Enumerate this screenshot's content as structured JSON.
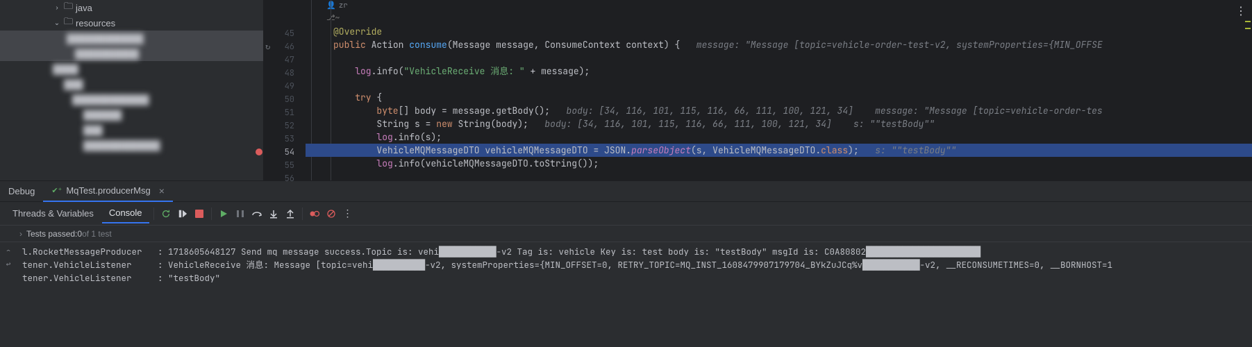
{
  "sidebar": {
    "items": [
      {
        "indent": 76,
        "chev": "›",
        "icon": "folder",
        "label": "java"
      },
      {
        "indent": 76,
        "chev": "⌄",
        "icon": "folder",
        "label": "resources"
      },
      {
        "indent": 96,
        "chev": "",
        "icon": "",
        "label": "████████████",
        "blur": true,
        "selected": true
      },
      {
        "indent": 108,
        "chev": "",
        "icon": "",
        "label": "██████████",
        "blur": true,
        "selected": true
      },
      {
        "indent": 76,
        "chev": "",
        "icon": "",
        "label": "████",
        "blur": true
      },
      {
        "indent": 92,
        "chev": "",
        "icon": "",
        "label": "███",
        "blur": true
      },
      {
        "indent": 104,
        "chev": "",
        "icon": "",
        "label": "████████████",
        "blur": true
      },
      {
        "indent": 120,
        "chev": "",
        "icon": "",
        "label": "██████",
        "blur": true
      },
      {
        "indent": 120,
        "chev": "",
        "icon": "",
        "label": "███",
        "blur": true
      },
      {
        "indent": 120,
        "chev": "",
        "icon": "",
        "label": "████████████",
        "blur": true
      }
    ]
  },
  "editor": {
    "author": "zr",
    "lens": "⎇~",
    "lines": [
      {
        "n": 45,
        "html": "<span class='c-ann'>@Override</span>"
      },
      {
        "n": 46,
        "icon": "⟳",
        "html": "<span class='c-kw'>public</span> <span class='c-type'>Action</span> <span class='c-fn'>consume</span><span class='c-paren'>(</span><span class='c-type'>Message</span> <span class='c-param'>message</span><span class='c-op'>,</span> <span class='c-type'>ConsumeContext</span> <span class='c-param'>context</span><span class='c-paren'>) {</span>   <span class='c-cmt'>message: \"Message [topic=vehicle-order-test-v2, systemProperties={MIN_OFFSE</span>"
      },
      {
        "n": 47,
        "html": ""
      },
      {
        "n": 48,
        "html": "    <span class='c-field'>log</span><span class='c-op'>.</span><span class='c-def'>info</span><span class='c-paren'>(</span><span class='c-str'>\"VehicleReceive 消息: \"</span> <span class='c-op'>+</span> <span class='c-param'>message</span><span class='c-paren'>);</span>"
      },
      {
        "n": 49,
        "html": ""
      },
      {
        "n": 50,
        "html": "    <span class='c-kw'>try</span> <span class='c-paren'>{</span>"
      },
      {
        "n": 51,
        "html": "        <span class='c-kw'>byte</span><span class='c-paren'>[]</span> <span class='c-def'>body</span> <span class='c-op'>=</span> <span class='c-param'>message</span><span class='c-op'>.</span><span class='c-def'>getBody</span><span class='c-paren'>();</span>   <span class='c-cmt'>body: [34, 116, 101, 115, 116, 66, 111, 100, 121, 34]    message: \"Message [topic=vehicle-order-tes</span>"
      },
      {
        "n": 52,
        "html": "        <span class='c-type'>String</span> <span class='c-def'>s</span> <span class='c-op'>=</span> <span class='c-kw'>new</span> <span class='c-type'>String</span><span class='c-paren'>(</span><span class='c-param'>body</span><span class='c-paren'>);</span>   <span class='c-cmt'>body: [34, 116, 101, 115, 116, 66, 111, 100, 121, 34]    s: \"\"testBody\"\"</span>"
      },
      {
        "n": 53,
        "html": "        <span class='c-field'>log</span><span class='c-op'>.</span><span class='c-def'>info</span><span class='c-paren'>(</span><span class='c-param'>s</span><span class='c-paren'>);</span>"
      },
      {
        "n": 54,
        "bp": true,
        "hl": true,
        "html": "        <span class='c-type'>VehicleMQMessageDTO</span> <span class='c-def'>vehicleMQMessageDTO</span> <span class='c-op'>=</span> <span class='c-type'>JSON</span><span class='c-op'>.</span><span class='c-meth'>parseObject</span><span class='c-paren'>(</span><span class='c-param'>s</span><span class='c-op'>,</span> <span class='c-type'>VehicleMQMessageDTO</span><span class='c-op'>.</span><span class='c-kw'>class</span><span class='c-paren'>);</span>   <span class='c-cmt'>s: \"\"testBody\"\"</span>"
      },
      {
        "n": 55,
        "html": "        <span class='c-field'>log</span><span class='c-op'>.</span><span class='c-def'>info</span><span class='c-paren'>(</span><span class='c-param'>vehicleMQMessageDTO</span><span class='c-op'>.</span><span class='c-def'>toString</span><span class='c-paren'>());</span>"
      },
      {
        "n": 56,
        "html": ""
      }
    ]
  },
  "debug": {
    "tab_main": "Debug",
    "tab_run": "MqTest.producerMsg",
    "subtabs": [
      "Threads & Variables",
      "Console"
    ],
    "active_subtab": 1,
    "toolbar": {
      "rerun": "↻",
      "run": "▷",
      "stop": "■",
      "resume": "▷",
      "pause": "‖",
      "step_over": "⤵",
      "step_into": "↓",
      "step_out": "↑",
      "view_bp": "◉",
      "mute_bp": "⊘",
      "more": "⋮"
    },
    "test_status": {
      "prefix": "Tests passed: ",
      "count": "0",
      "suffix": " of 1 test"
    },
    "console_lines": [
      "l.RocketMessageProducer   : 1718605648127 Send mq message success.Topic is: vehi███████████-v2 Tag is: vehicle Key is: test body is: \"testBody\" msgId is: C0A80802██████████████████████",
      "",
      "tener.VehicleListener     : VehicleReceive 消息: Message [topic=vehi██████████-v2, systemProperties={MIN_OFFSET=0, RETRY_TOPIC=MQ_INST_1608479907179704_BYkZuJCq%v███████████-v2, __RECONSUMETIMES=0, __BORNHOST=1",
      "tener.VehicleListener     : \"testBody\""
    ]
  }
}
